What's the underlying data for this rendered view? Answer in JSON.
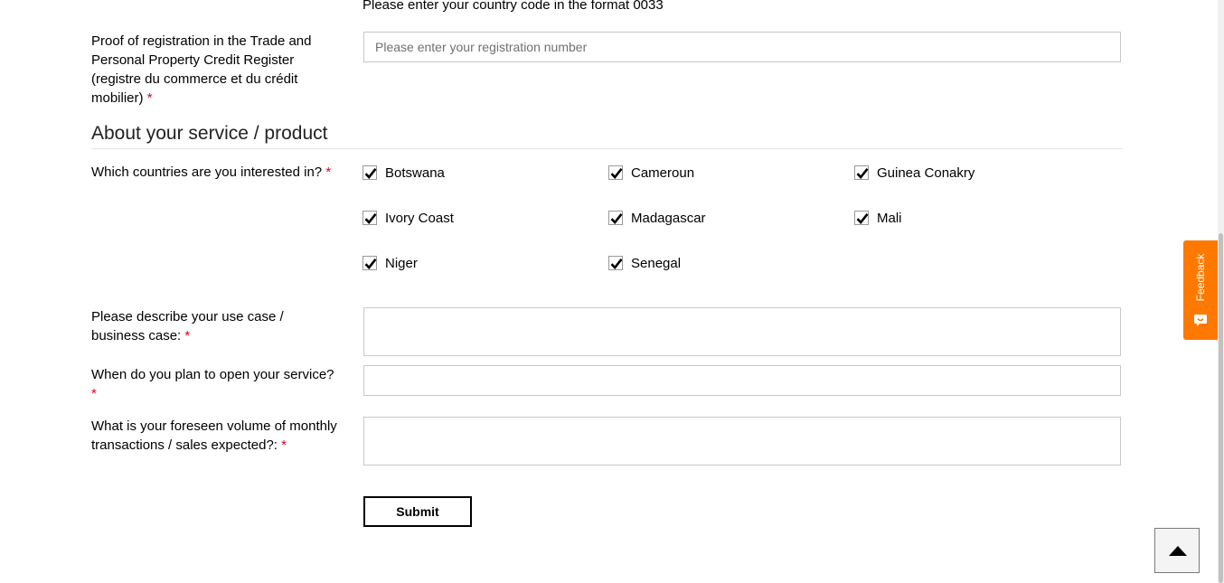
{
  "hint_country_code": "Please enter your country code in the format 0033",
  "registration": {
    "label": "Proof of registration in the Trade and Personal Property Credit Register (registre du commerce et du crédit mobilier)",
    "required": "*",
    "placeholder": "Please enter your registration number",
    "value": ""
  },
  "section_title": "About your service / product",
  "countries": {
    "label": "Which countries are you interested in?",
    "required": "*",
    "options": [
      {
        "label": "Botswana",
        "checked": true
      },
      {
        "label": "Cameroun",
        "checked": true
      },
      {
        "label": "Guinea Conakry",
        "checked": true
      },
      {
        "label": "Ivory Coast",
        "checked": true
      },
      {
        "label": "Madagascar",
        "checked": true
      },
      {
        "label": "Mali",
        "checked": true
      },
      {
        "label": "Niger",
        "checked": true
      },
      {
        "label": "Senegal",
        "checked": true
      }
    ]
  },
  "use_case": {
    "label": "Please describe your use case / business case:",
    "required": "*",
    "value": ""
  },
  "open_date": {
    "label": "When do you plan to open your service?",
    "required": "*",
    "value": ""
  },
  "volume": {
    "label": "What is your foreseen volume of monthly transactions / sales expected?:",
    "required": "*",
    "value": ""
  },
  "submit_label": "Submit",
  "feedback_label": "Feedback",
  "colors": {
    "accent": "#ff7900",
    "required": "#e0001a"
  },
  "icons": {
    "checkbox": "check-icon",
    "feedback": "feedback-smile-icon",
    "scroll_top": "arrow-up-icon"
  }
}
